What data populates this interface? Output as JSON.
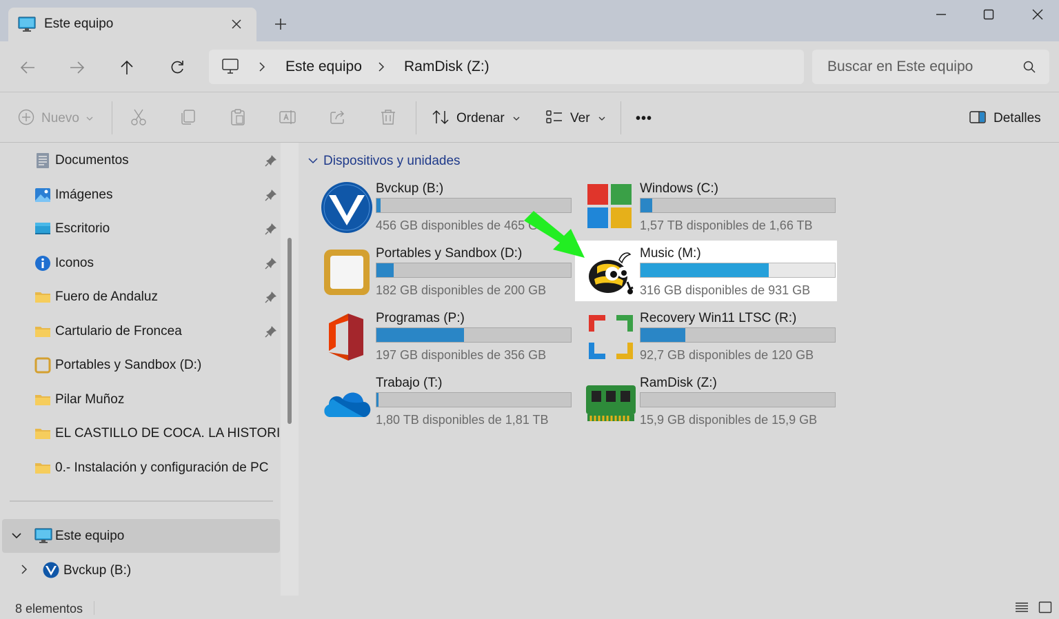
{
  "titlebar": {
    "tab_title": "Este equipo",
    "tab_icon": "monitor-icon",
    "new_tab_icon": "plus-icon",
    "window_controls": [
      "minimize-icon",
      "maximize-icon",
      "close-icon"
    ]
  },
  "address": {
    "root_icon": "computer-icon",
    "crumbs": [
      "Este equipo",
      "RamDisk (Z:)"
    ],
    "search_placeholder": "Buscar en Este equipo"
  },
  "commands": {
    "new_label": "Nuevo",
    "sort_label": "Ordenar",
    "view_label": "Ver",
    "more_label": "•••",
    "details_label": "Detalles"
  },
  "sidebar": {
    "pinned": [
      {
        "label": "Documentos",
        "icon": "document-icon"
      },
      {
        "label": "Imágenes",
        "icon": "pictures-icon"
      },
      {
        "label": "Escritorio",
        "icon": "desktop-icon"
      },
      {
        "label": "Iconos",
        "icon": "info-icon"
      },
      {
        "label": "Fuero de Andaluz",
        "icon": "folder-icon"
      },
      {
        "label": "Cartulario de Froncea",
        "icon": "folder-icon"
      }
    ],
    "others": [
      {
        "label": "Portables y Sandbox (D:)",
        "icon": "drive-d-icon"
      },
      {
        "label": "Pilar Muñoz",
        "icon": "folder-icon"
      },
      {
        "label": "EL CASTILLO DE COCA. LA HISTORIA, EL ARTE",
        "icon": "folder-icon"
      },
      {
        "label": "0.- Instalación y configuración de PC",
        "icon": "folder-icon"
      }
    ],
    "this_pc": "Este equipo",
    "bvckup": "Bvckup (B:)"
  },
  "content": {
    "group_title": "Dispositivos y unidades",
    "drives": [
      {
        "name": "Bvckup (B:)",
        "info": "456 GB disponibles de 465 GB",
        "used": 0.02,
        "icon": "bvckup-icon",
        "highlight": false
      },
      {
        "name": "Windows (C:)",
        "info": "1,57 TB disponibles de 1,66 TB",
        "used": 0.06,
        "icon": "windows-icon",
        "highlight": false
      },
      {
        "name": "Portables y Sandbox (D:)",
        "info": "182 GB disponibles de 200 GB",
        "used": 0.09,
        "icon": "sandbox-icon",
        "highlight": false
      },
      {
        "name": "Music (M:)",
        "info": "316 GB disponibles de 931 GB",
        "used": 0.66,
        "icon": "musicbee-icon",
        "highlight": true
      },
      {
        "name": "Programas (P:)",
        "info": "197 GB disponibles de 356 GB",
        "used": 0.45,
        "icon": "office-icon",
        "highlight": false
      },
      {
        "name": "Recovery Win11 LTSC (R:)",
        "info": "92,7 GB disponibles de 120 GB",
        "used": 0.23,
        "icon": "recovery-icon",
        "highlight": false
      },
      {
        "name": "Trabajo (T:)",
        "info": "1,80 TB disponibles de 1,81 TB",
        "used": 0.01,
        "icon": "onedrive-icon",
        "highlight": false
      },
      {
        "name": "RamDisk (Z:)",
        "info": "15,9 GB disponibles de 15,9 GB",
        "used": 0.0,
        "icon": "ramdisk-icon",
        "highlight": false
      }
    ]
  },
  "status": {
    "count": "8 elementos"
  },
  "colors": {
    "accent": "#2a86c6",
    "highlight_bar": "#26a0da",
    "arrow": "#22ee22"
  }
}
